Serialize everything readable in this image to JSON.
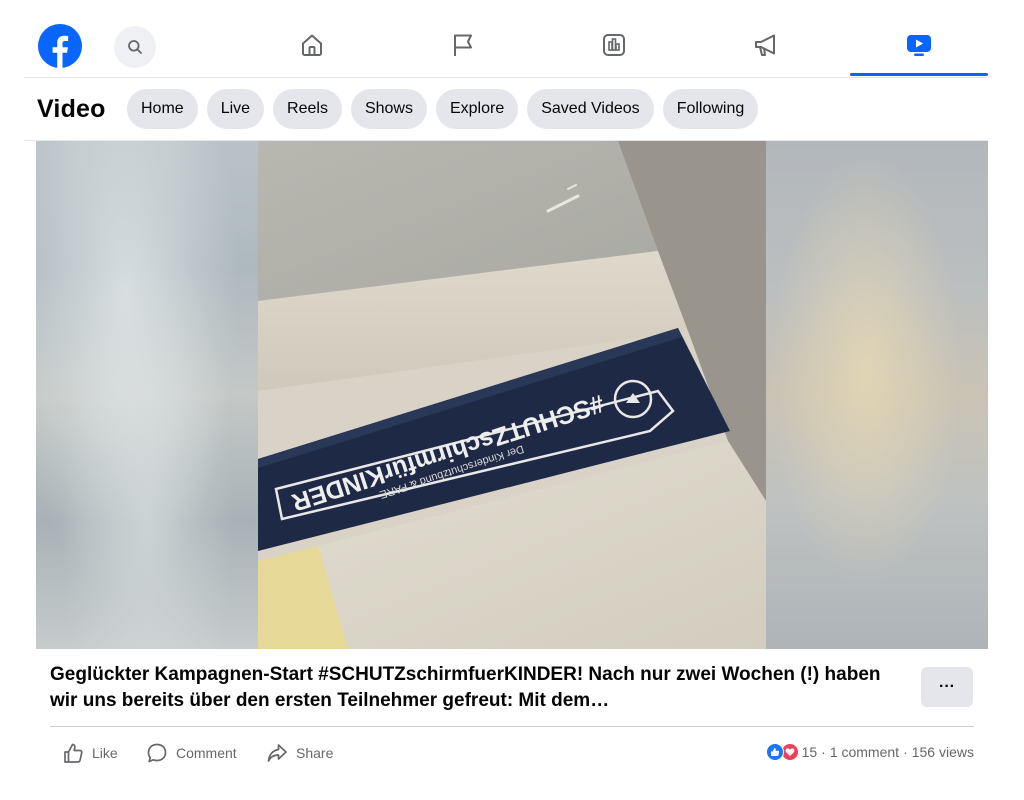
{
  "nav": {
    "icons": [
      "facebook-logo",
      "search-icon",
      "home-icon",
      "flag-icon",
      "chart-icon",
      "megaphone-icon",
      "video-icon"
    ],
    "active": "video-icon"
  },
  "subnav": {
    "title": "Video",
    "tabs": [
      "Home",
      "Live",
      "Reels",
      "Shows",
      "Explore",
      "Saved Videos",
      "Following"
    ]
  },
  "video": {
    "banner_text": "#SCHUTZschirmfürKINDER",
    "banner_subtext": "Der Kinderschutzbund & FARE"
  },
  "post": {
    "caption": "Geglückter Kampagnen-Start #SCHUTZschirmfuerKINDER! Nach nur zwei Wochen (!) haben wir uns bereits über den ersten Teilnehmer gefreut: Mit dem…",
    "more_label": "···"
  },
  "actions": {
    "like": "Like",
    "comment": "Comment",
    "share": "Share"
  },
  "stats": {
    "reaction_count": "15",
    "comments": "1 comment",
    "views": "156 views",
    "separator": "·"
  },
  "colors": {
    "brand": "#0866ff",
    "pill_bg": "#e4e6eb",
    "like": "#1877f2",
    "love": "#f33e58"
  }
}
